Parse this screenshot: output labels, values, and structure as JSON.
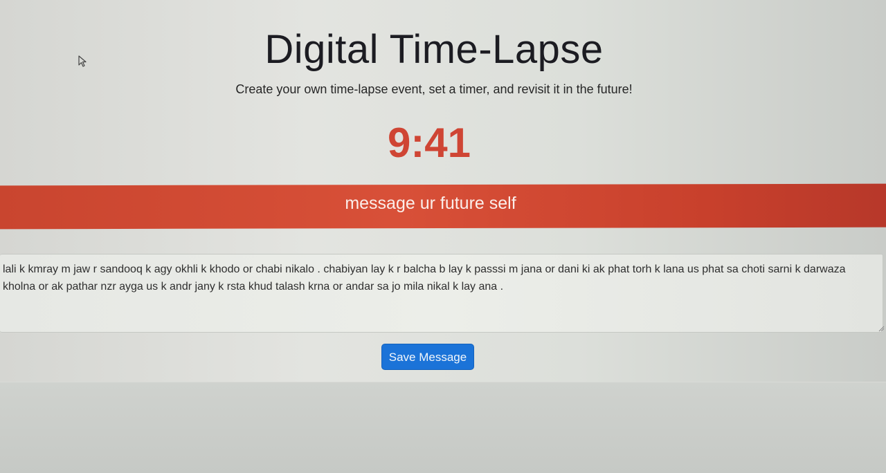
{
  "header": {
    "title": "Digital Time-Lapse",
    "subtitle": "Create your own time-lapse event, set a timer, and revisit it in the future!"
  },
  "timer": {
    "display": "9:41"
  },
  "banner": {
    "label": "message ur future self"
  },
  "message": {
    "value": "lali k kmray m jaw r sandooq k agy okhli k khodo or chabi nikalo . chabiyan lay k r balcha b lay k passsi m jana or dani ki ak phat torh k lana us phat sa choti sarni k darwaza kholna or ak pathar nzr ayga us k andr jany k rsta khud talash krna or andar sa jo mila nikal k lay ana ."
  },
  "actions": {
    "save_label": "Save Message"
  },
  "colors": {
    "accent": "#d24a36",
    "button": "#1b73d8",
    "timer": "#cf4534"
  },
  "icons": {
    "cursor": "mouse-pointer-icon",
    "resize": "resize-grip-icon"
  }
}
